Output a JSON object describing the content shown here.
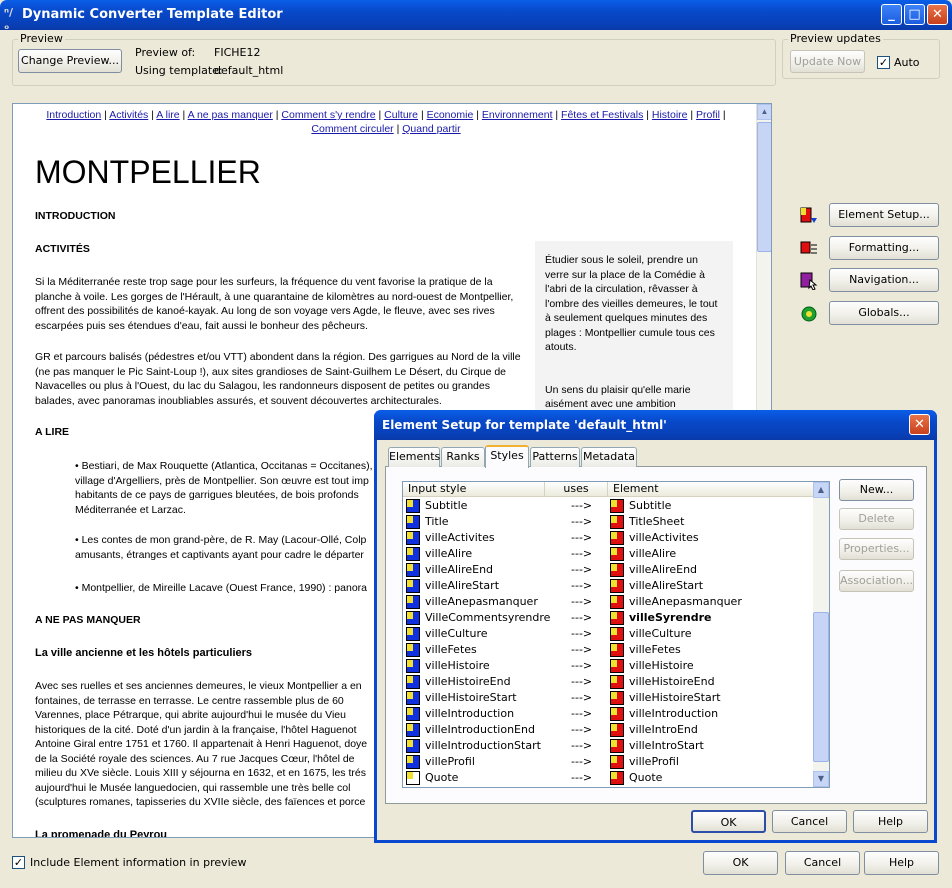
{
  "window": {
    "title": "Dynamic Converter Template Editor",
    "minimize": "_",
    "maximize": "□",
    "close": "✕"
  },
  "preview_group": {
    "label": "Preview",
    "change_button": "Change Preview...",
    "preview_of_label": "Preview of:",
    "preview_of_value": "FICHE12",
    "using_template_label": "Using template:",
    "using_template_value": "default_html"
  },
  "updates_group": {
    "label": "Preview updates",
    "update_button": "Update Now",
    "auto_label": "Auto",
    "auto_checked": "✓"
  },
  "page": {
    "nav_links": [
      "Introduction",
      "Activités",
      "A lire",
      "A ne pas manquer",
      "Comment s'y rendre",
      "Culture",
      "Economie",
      "Environnement",
      "Fêtes et Festivals",
      "Histoire",
      "Profil",
      "Comment circuler",
      "Quand partir"
    ],
    "title": "MONTPELLIER",
    "sec_intro": "INTRODUCTION",
    "sec_activites": "ACTIVITÉS",
    "para1": "Si la Méditerranée reste trop sage pour les surfeurs, la fréquence du vent favorise la pratique de la planche à voile. Les gorges de l'Hérault, à une quarantaine de kilomètres au nord-ouest de Montpellier, offrent des possibilités de kanoé-kayak. Au long de son voyage vers Agde, le fleuve, avec ses rives escarpées puis ses étendues d'eau, fait aussi le bonheur des pêcheurs.",
    "para2": "GR et parcours balisés (pédestres et/ou VTT) abondent dans la région. Des garrigues au Nord de la ville (ne pas manquer le Pic Saint-Loup !), aux sites grandioses de Saint-Guilhem Le Désert, du Cirque de Navacelles ou plus à l'Ouest, du lac du Salagou, les randonneurs disposent de petites ou grandes balades, avec panoramas inoubliables assurés, et souvent découvertes architecturales.",
    "sec_alire": "A LIRE",
    "bullet1": "• Bestiari, de Max Rouquette (Atlantica, Occitanas = Occitanes), village d'Argelliers, près de Montpellier. Son œuvre est tout imp habitants de ce pays de garrigues bleutées, de bois profonds Méditerranée et Larzac.",
    "bullet2": "• Les contes de mon grand-père, de R. May (Lacour-Ollé, Colp amusants, étranges et captivants ayant pour cadre le départer",
    "bullet3": "• Montpellier, de Mireille Lacave (Ouest France, 1990) : panora",
    "sec_anepas": "A NE PAS MANQUER",
    "sub_ville": "La ville ancienne et les hôtels particuliers",
    "para3": "Avec ses ruelles et ses anciennes demeures, le vieux Montpellier a en fontaines, de terrasse en terrasse. Le centre rassemble plus de 60 Varennes, place Pétrarque, qui abrite aujourd'hui le musée du Vieu historiques de la cité. Doté d'un jardin à la française, l'hôtel Haguenot Antoine Giral entre 1751 et 1760. Il appartenait à Henri Haguenot, doye de la Société royale des sciences. Au 7 rue Jacques Cœur, l'hôtel de milieu du XVe siècle. Louis XIII y séjourna en 1632, et en 1675, les trés aujourd'hui le Musée languedocien, qui rassemble une très belle col (sculptures romanes, tapisseries du XVIIe siècle, des faïences et porce",
    "sec_promenade": "La promenade du Peyrou",
    "sidebox1": "Étudier sous le soleil, prendre un verre sur la place de la Comédie à l'abri de la circulation, rêvasser à l'ombre des vieilles demeures, le tout à seulement quelques minutes des plages : Montpellier cumule tous ces atouts.",
    "sidebox2": "Un sens du plaisir qu'elle marie aisément avec une ambition"
  },
  "side_buttons": {
    "element_setup": "Element Setup...",
    "formatting": "Formatting...",
    "navigation": "Navigation...",
    "globals": "Globals..."
  },
  "bottom": {
    "include_label": "Include Element information in preview",
    "include_checked": "✓",
    "ok": "OK",
    "cancel": "Cancel",
    "help": "Help"
  },
  "dialog": {
    "title": "Element Setup for template 'default_html'",
    "close": "✕",
    "tabs": [
      "Elements",
      "Ranks",
      "Styles",
      "Patterns",
      "Metadata"
    ],
    "active_tab": "Styles",
    "columns": [
      "Input style",
      "uses",
      "Element"
    ],
    "rows": [
      {
        "input": "Subtitle",
        "uses": "--->",
        "element": "Subtitle",
        "bold": false
      },
      {
        "input": "Title",
        "uses": "--->",
        "element": "TitleSheet",
        "bold": false
      },
      {
        "input": "villeActivites",
        "uses": "--->",
        "element": "villeActivites",
        "bold": false
      },
      {
        "input": "villeAlire",
        "uses": "--->",
        "element": "villeAlire",
        "bold": false
      },
      {
        "input": "villeAlireEnd",
        "uses": "--->",
        "element": "villeAlireEnd",
        "bold": false
      },
      {
        "input": "villeAlireStart",
        "uses": "--->",
        "element": "villeAlireStart",
        "bold": false
      },
      {
        "input": "villeAnepasmanquer",
        "uses": "--->",
        "element": "villeAnepasmanquer",
        "bold": false
      },
      {
        "input": "VilleCommentsyrendre",
        "uses": "--->",
        "element": "villeSyrendre",
        "bold": true
      },
      {
        "input": "villeCulture",
        "uses": "--->",
        "element": "villeCulture",
        "bold": false
      },
      {
        "input": "villeFetes",
        "uses": "--->",
        "element": "villeFetes",
        "bold": false
      },
      {
        "input": "villeHistoire",
        "uses": "--->",
        "element": "villeHistoire",
        "bold": false
      },
      {
        "input": "villeHistoireEnd",
        "uses": "--->",
        "element": "villeHistoireEnd",
        "bold": false
      },
      {
        "input": "villeHistoireStart",
        "uses": "--->",
        "element": "villeHistoireStart",
        "bold": false
      },
      {
        "input": "villeIntroduction",
        "uses": "--->",
        "element": "villeIntroduction",
        "bold": false
      },
      {
        "input": "villeIntroductionEnd",
        "uses": "--->",
        "element": "villeIntroEnd",
        "bold": false
      },
      {
        "input": "villeIntroductionStart",
        "uses": "--->",
        "element": "villeIntroStart",
        "bold": false
      },
      {
        "input": "villeProfil",
        "uses": "--->",
        "element": "villeProfil",
        "bold": false
      },
      {
        "input": "Quote",
        "uses": "--->",
        "element": "Quote",
        "bold": false
      }
    ],
    "buttons": {
      "new": "New...",
      "delete": "Delete",
      "properties": "Properties...",
      "association": "Association..."
    },
    "ok": "OK",
    "cancel": "Cancel",
    "help": "Help"
  }
}
